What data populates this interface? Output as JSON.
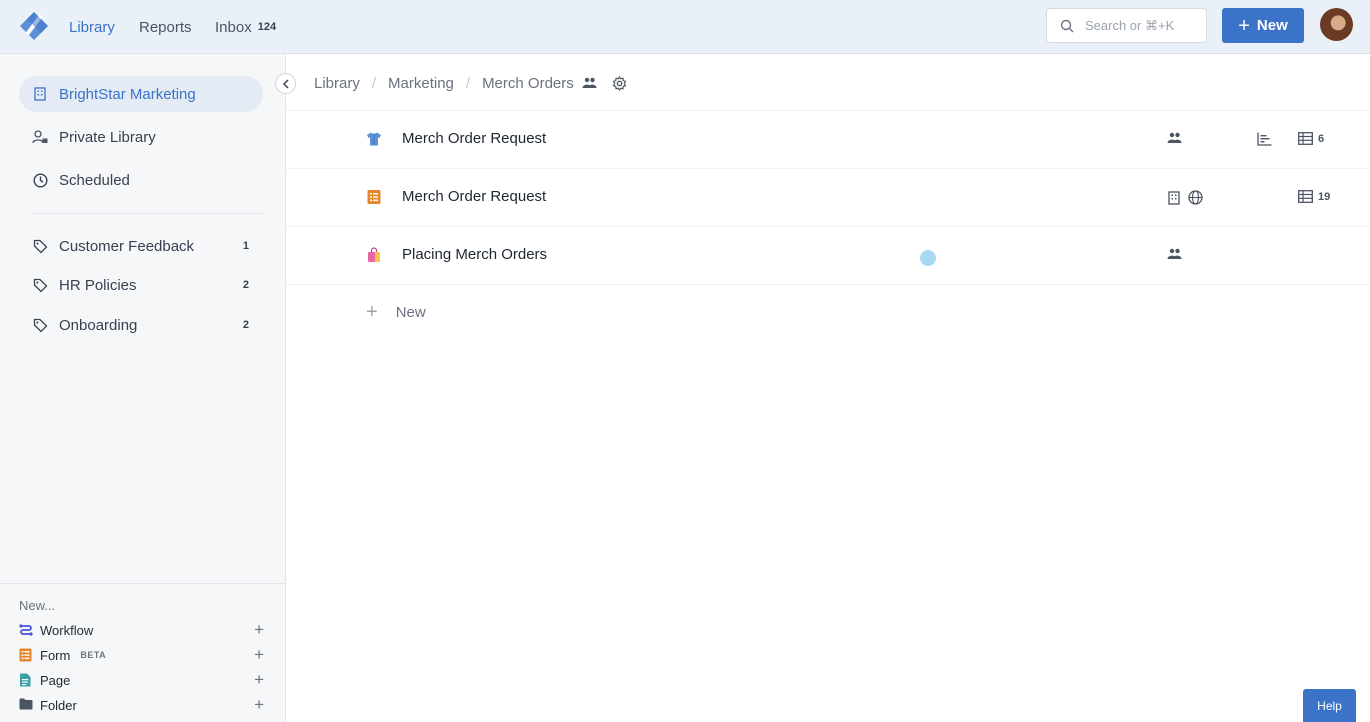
{
  "topbar": {
    "nav": {
      "library": "Library",
      "reports": "Reports",
      "inbox": "Inbox",
      "inbox_count": "124"
    },
    "search_placeholder": "Search or ⌘+K",
    "new_label": "New",
    "accent_color": "#3b73c8"
  },
  "sidebar": {
    "items": [
      {
        "label": "BrightStar Marketing",
        "icon": "building-icon",
        "active": true
      },
      {
        "label": "Private Library",
        "icon": "user-lock-icon"
      },
      {
        "label": "Scheduled",
        "icon": "clock-icon"
      }
    ],
    "tags": [
      {
        "label": "Customer Feedback",
        "count": "1",
        "icon": "tag-icon"
      },
      {
        "label": "HR Policies",
        "count": "2",
        "icon": "tag-icon"
      },
      {
        "label": "Onboarding",
        "count": "2",
        "icon": "tag-icon"
      }
    ],
    "new_section": {
      "heading": "New...",
      "items": [
        {
          "label": "Workflow",
          "icon": "workflow-icon"
        },
        {
          "label": "Form",
          "badge": "BETA",
          "icon": "form-icon"
        },
        {
          "label": "Page",
          "icon": "page-icon"
        },
        {
          "label": "Folder",
          "icon": "folder-icon"
        }
      ]
    }
  },
  "breadcrumb": {
    "library": "Library",
    "marketing": "Marketing",
    "current": "Merch Orders"
  },
  "rows": [
    {
      "title": "Merch Order Request",
      "icon": "shirt-icon",
      "count": "6"
    },
    {
      "title": "Merch Order Request",
      "icon": "form-icon",
      "count": "19"
    },
    {
      "title": "Placing Merch Orders",
      "icon": "shopping-bag-icon"
    }
  ],
  "new_row_label": "New",
  "help_label": "Help"
}
